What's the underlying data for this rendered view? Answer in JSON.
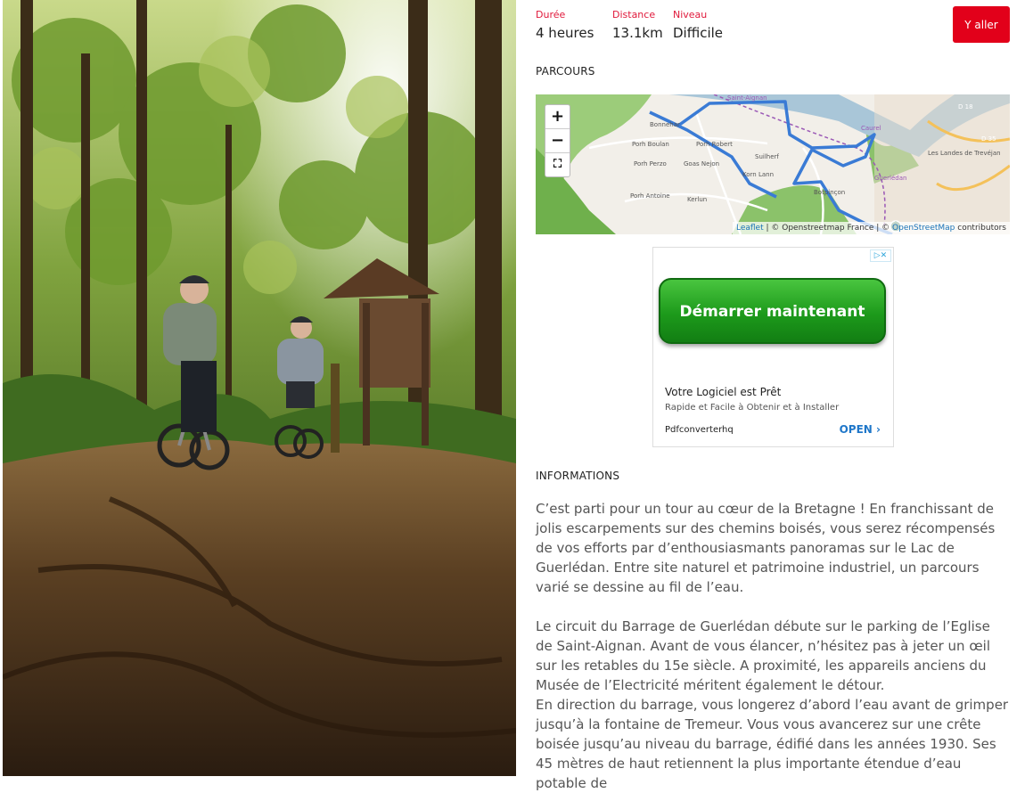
{
  "stats": [
    {
      "label": "Durée",
      "value": "4 heures"
    },
    {
      "label": "Distance",
      "value": "13.1km"
    },
    {
      "label": "Niveau",
      "value": "Difficile"
    }
  ],
  "cta_label": "Y aller",
  "parcours_title": "PARCOURS",
  "map": {
    "zoom_in": "+",
    "zoom_out": "−",
    "fullscreen": "⛶",
    "place_labels": [
      "Saint-Aignan",
      "Bonnehar",
      "Porh Boulan",
      "Porh Robert",
      "Suilherf",
      "Porh Perzo",
      "Goas Nejon",
      "Korn Lann",
      "Porh Antoine",
      "Kerlun",
      "Botpinçon",
      "Les Landes de Trevéjan",
      "D 18",
      "D 35",
      "Caurel",
      "Guerlédan"
    ],
    "attribution": {
      "leaflet": "Leaflet",
      "sep1": " | © Openstreetmap France | © ",
      "osm": "OpenStreetMap",
      "tail": " contributors"
    },
    "colors": {
      "route": "#3a7bd5",
      "water": "#a9c6d8",
      "forest": "#79b65e"
    }
  },
  "ad": {
    "flag": "▷✕",
    "cta": "Démarrer maintenant",
    "title": "Votre Logiciel est Prêt",
    "subtitle": "Rapide et Facile à Obtenir et à Installer",
    "brand": "Pdfconverterhq",
    "open": "OPEN"
  },
  "informations_title": "INFORMATIONS",
  "paragraphs": [
    "C’est parti pour un tour au cœur de la Bretagne ! En franchissant de jolis escarpements sur des chemins boisés, vous serez récompensés de vos efforts par d’enthousiasmants panoramas sur le Lac de Guerlédan. Entre site naturel et patrimoine industriel, un parcours varié se dessine au fil de l’eau.",
    "Le circuit du Barrage de Guerlédan débute sur le parking de l’Eglise de Saint-Aignan. Avant de vous élancer, n’hésitez pas à jeter un œil sur les retables du 15e siècle. A proximité, les appareils anciens du Musée de l’Electricité méritent également le détour.",
    "En direction du barrage, vous longerez d’abord l’eau avant de grimper jusqu’à la fontaine de Tremeur. Vous vous avancerez sur une crête boisée jusqu’au niveau du barrage, édifié dans les années 1930. Ses 45 mètres de haut retiennent la plus importante étendue d’eau potable de"
  ],
  "accent_color": "#e2001a"
}
